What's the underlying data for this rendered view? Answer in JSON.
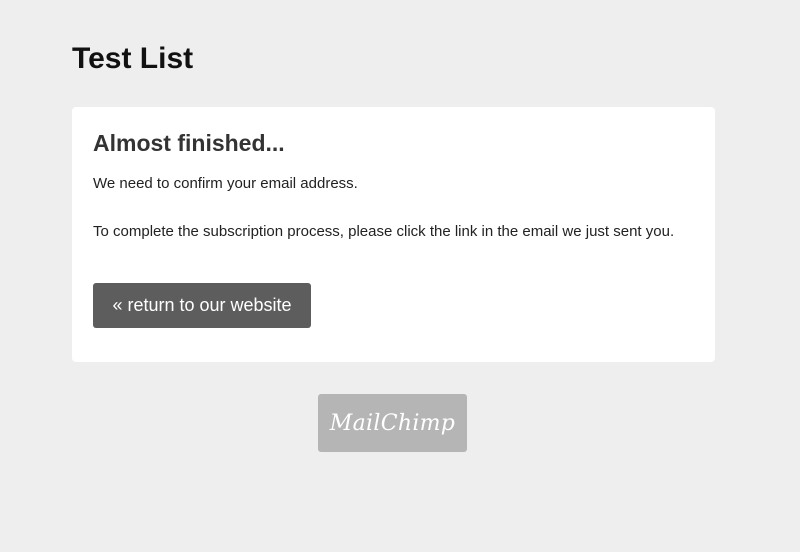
{
  "list": {
    "title": "Test List"
  },
  "card": {
    "heading": "Almost finished...",
    "line1": "We need to confirm your email address.",
    "line2": "To complete the subscription process, please click the link in the email we just sent you.",
    "return_button": "« return to our website"
  },
  "footer": {
    "badge_text": "MailChimp"
  },
  "colors": {
    "background": "#eeeeee",
    "card": "#ffffff",
    "button": "#5d5d5d",
    "badge": "#b5b5b5"
  }
}
